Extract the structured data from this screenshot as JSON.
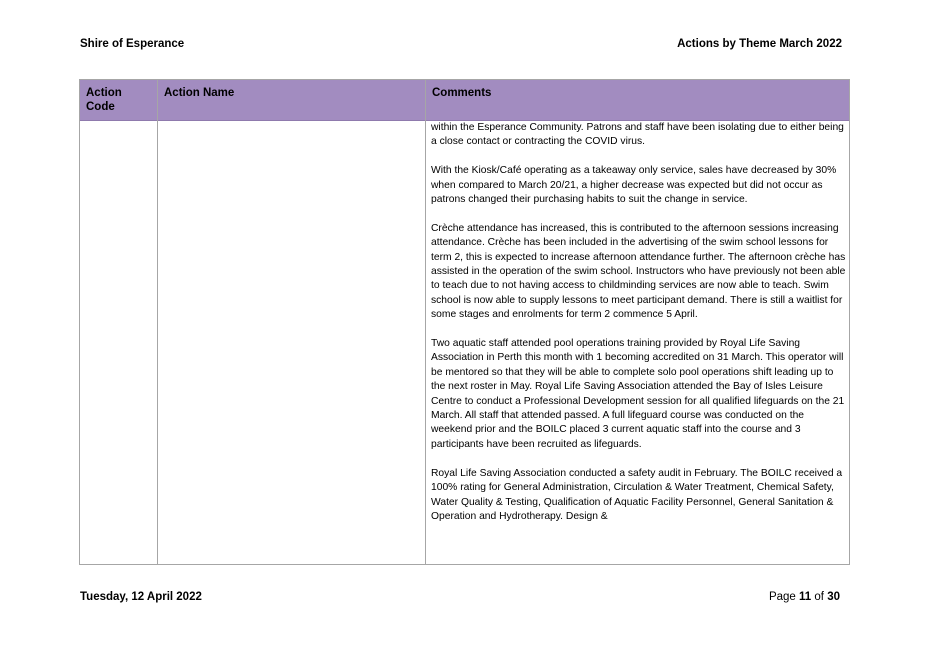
{
  "header": {
    "org": "Shire of Esperance",
    "report": "Actions by Theme March 2022"
  },
  "table": {
    "columns": [
      "Action Code",
      "Action Name",
      "Comments"
    ],
    "comments": [
      "within the Esperance Community. Patrons and staff have been isolating due to either being a close contact or contracting the COVID virus.",
      "With the Kiosk/Café operating as a takeaway only service, sales have decreased by 30% when compared to March 20/21, a higher decrease was expected but did not occur as patrons changed their purchasing habits to suit the change in service.",
      "Crèche attendance has increased, this is contributed to the afternoon sessions increasing attendance. Crèche has been included in the advertising of the swim school lessons for term 2, this is expected to increase afternoon attendance further. The afternoon crèche has assisted in the operation of the swim school. Instructors who have previously not been able to teach due to not having access to childminding services are now able to teach. Swim school is now able to supply lessons to meet participant demand. There is still a waitlist for some stages and enrolments for term 2 commence 5 April.",
      "Two aquatic staff attended pool operations training provided by Royal Life Saving Association in Perth this month with 1 becoming accredited on 31 March. This operator will be mentored so that they will be able to complete solo pool operations shift leading up to the next roster in May. Royal Life Saving Association attended the Bay of Isles Leisure Centre to conduct a Professional Development session for all qualified lifeguards on the 21 March. All staff that attended passed. A full lifeguard course was conducted on the weekend prior and the BOILC placed 3 current aquatic staff into the course and 3 participants have been recruited as lifeguards.",
      "Royal Life Saving Association conducted a safety audit in February. The BOILC received a 100% rating for General Administration, Circulation & Water Treatment, Chemical Safety, Water Quality & Testing, Qualification of Aquatic Facility Personnel, General Sanitation & Operation and Hydrotherapy. Design &"
    ]
  },
  "footer": {
    "date": "Tuesday, 12 April 2022",
    "page_prefix": "Page",
    "page_current": "11",
    "page_of": "of",
    "page_total": "30"
  }
}
